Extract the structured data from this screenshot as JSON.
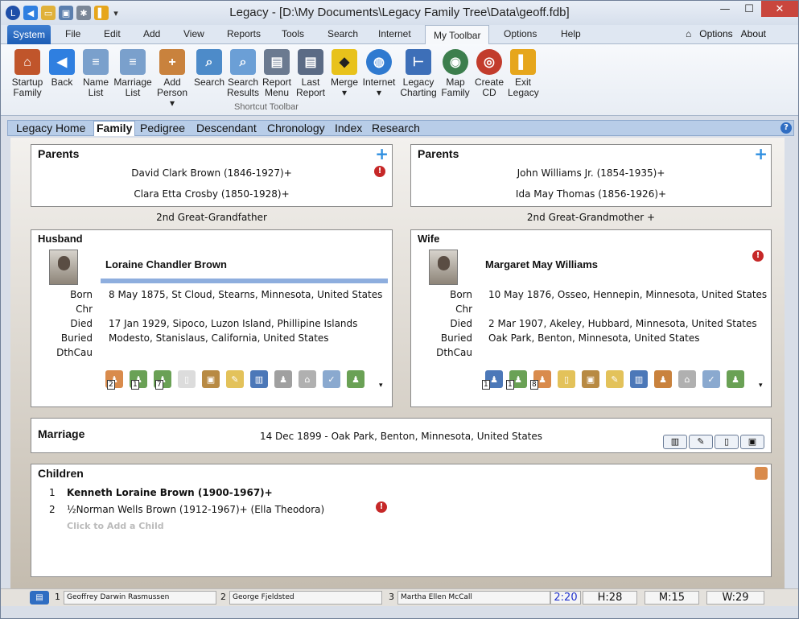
{
  "window": {
    "title": "Legacy - [D:\\My Documents\\Legacy Family Tree\\Data\\geoff.fdb]"
  },
  "menus": [
    "System",
    "File",
    "Edit",
    "Add",
    "View",
    "Reports",
    "Tools",
    "Search",
    "Internet",
    "My Toolbar",
    "Options",
    "Help"
  ],
  "right_menu": {
    "options": "Options",
    "about": "About"
  },
  "toolbar": {
    "group_label": "Shortcut Toolbar",
    "items": [
      {
        "label1": "Startup",
        "label2": "Family",
        "icon": "house-icon",
        "color": "#c0552b"
      },
      {
        "label1": "Back",
        "label2": "",
        "icon": "back-arrow-icon",
        "color": "#2f7fe0"
      },
      {
        "label1": "Name",
        "label2": "List",
        "icon": "list-icon",
        "color": "#7aa0cc"
      },
      {
        "label1": "Marriage",
        "label2": "List",
        "icon": "list-icon",
        "color": "#7aa0cc"
      },
      {
        "label1": "Add",
        "label2": "Person",
        "icon": "add-person-icon",
        "color": "#c9823d"
      },
      {
        "label1": "Search",
        "label2": "",
        "icon": "magnifier-icon",
        "color": "#4d8bc9"
      },
      {
        "label1": "Search",
        "label2": "Results",
        "icon": "search-results-icon",
        "color": "#6b9fd6"
      },
      {
        "label1": "Report",
        "label2": "Menu",
        "icon": "report-icon",
        "color": "#6b7a90"
      },
      {
        "label1": "Last",
        "label2": "Report",
        "icon": "last-report-icon",
        "color": "#5b6b85"
      },
      {
        "label1": "Merge",
        "label2": "",
        "icon": "merge-sign-icon",
        "color": "#e8c21b"
      },
      {
        "label1": "Internet",
        "label2": "",
        "icon": "globe-icon",
        "color": "#2f7ad0"
      },
      {
        "label1": "Legacy",
        "label2": "Charting",
        "icon": "chart-icon",
        "color": "#3d6fb8"
      },
      {
        "label1": "Map",
        "label2": "Family",
        "icon": "map-icon",
        "color": "#3c7e4d"
      },
      {
        "label1": "Create",
        "label2": "CD",
        "icon": "cd-icon",
        "color": "#c23c2c"
      },
      {
        "label1": "Exit",
        "label2": "Legacy",
        "icon": "exit-icon",
        "color": "#e6a61c"
      }
    ]
  },
  "tabs": [
    "Legacy Home",
    "Family",
    "Pedigree",
    "Descendant",
    "Chronology",
    "Index",
    "Research"
  ],
  "family": {
    "left_parents": {
      "title": "Parents",
      "father": "David Clark Brown (1846-1927)+",
      "mother": "Clara Etta Crosby (1850-1928)+",
      "relation": "2nd Great-Grandfather"
    },
    "right_parents": {
      "title": "Parents",
      "father": "John Williams Jr. (1854-1935)+",
      "mother": "Ida May Thomas (1856-1926)+",
      "relation": "2nd Great-Grandmother +"
    },
    "husband": {
      "title": "Husband",
      "name": "Loraine Chandler Brown",
      "born": "8 May 1875, St Cloud, Stearns, Minnesota, United States",
      "chr": "",
      "died": "17 Jan 1929, Sipoco, Luzon Island, Phillipine Islands",
      "buried": "Modesto, Stanislaus, California, United States",
      "dthcau": "",
      "badges": [
        "2",
        "1",
        "7"
      ]
    },
    "wife": {
      "title": "Wife",
      "name": "Margaret May Williams",
      "born": "10 May 1876, Osseo, Hennepin, Minnesota, United States",
      "chr": "",
      "died": "2 Mar 1907, Akeley, Hubbard, Minnesota, United States",
      "buried": "Oak Park, Benton, Minnesota, United States",
      "dthcau": "",
      "badges": [
        "1",
        "1",
        "8"
      ]
    },
    "labels": {
      "born": "Born",
      "chr": "Chr",
      "died": "Died",
      "buried": "Buried",
      "dthcau": "DthCau"
    },
    "marriage": {
      "title": "Marriage",
      "event": "14 Dec 1899 - Oak Park, Benton, Minnesota, United States"
    },
    "children": {
      "title": "Children",
      "items": [
        {
          "n": "1",
          "name": "Kenneth Loraine Brown (1900-1967)+"
        },
        {
          "n": "2",
          "name": "½Norman Wells Brown (1912-1967)+ (Ella Theodora)"
        }
      ],
      "add": "Click to Add a Child"
    }
  },
  "status": {
    "slot1": {
      "n": "1",
      "name": "Geoffrey Darwin Rasmussen"
    },
    "slot2": {
      "n": "2",
      "name": "George Fjeldsted"
    },
    "slot3": {
      "n": "3",
      "name": "Martha Ellen McCall"
    },
    "time": "2:20",
    "h": "H:28",
    "m": "M:15",
    "w": "W:29"
  }
}
